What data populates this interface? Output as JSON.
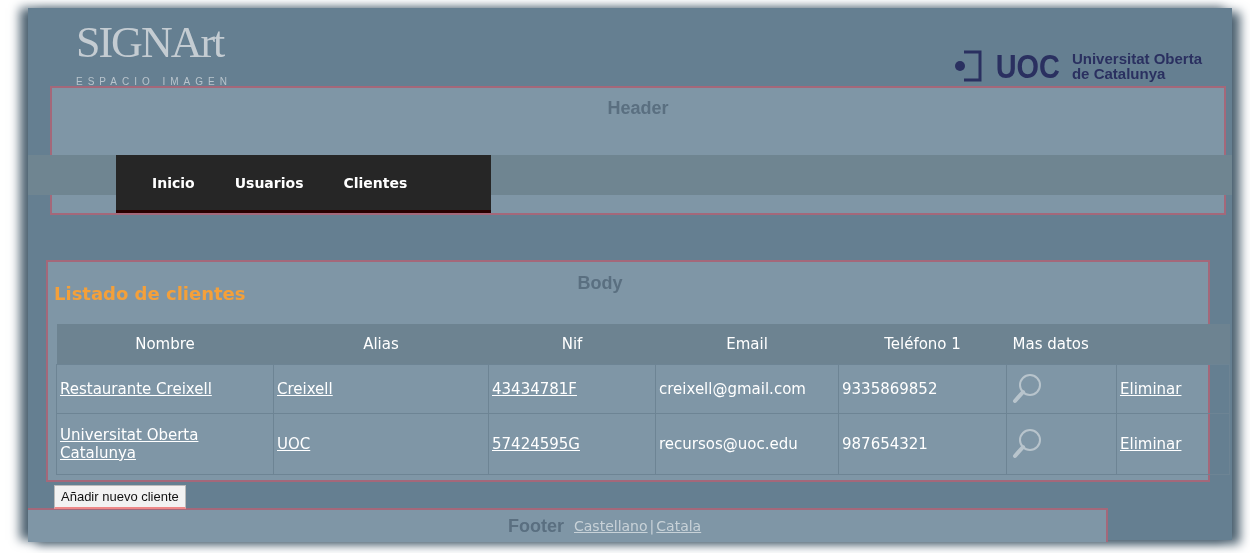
{
  "logos": {
    "left": {
      "name": "SIGNArt",
      "tagline": "ESPACIO IMAGEN"
    },
    "right": {
      "mark": "UOC",
      "line_1": "Universitat Oberta",
      "line_2": "de Catalunya"
    }
  },
  "header": {
    "label": "Header",
    "nav": [
      "Inicio",
      "Usuarios",
      "Clientes"
    ]
  },
  "body": {
    "label": "Body",
    "title": "Listado de clientes",
    "table": {
      "columns": [
        "Nombre",
        "Alias",
        "Nif",
        "Email",
        "Teléfono 1",
        "Mas datos"
      ],
      "rows": [
        {
          "nombre": "Restaurante Creixell",
          "alias": "Creixell",
          "nif": "43434781F",
          "email": "creixell@gmail.com",
          "telefono": "9335869852",
          "action": "Eliminar"
        },
        {
          "nombre": "Universitat Oberta Catalunya",
          "alias": "UOC",
          "nif": "57424595G",
          "email": "recursos@uoc.edu",
          "telefono": "987654321",
          "action": "Eliminar"
        }
      ]
    },
    "add_button": "Añadir nuevo cliente"
  },
  "footer": {
    "label": "Footer",
    "languages": [
      "Castellano",
      "Catala"
    ],
    "separator": "|"
  }
}
